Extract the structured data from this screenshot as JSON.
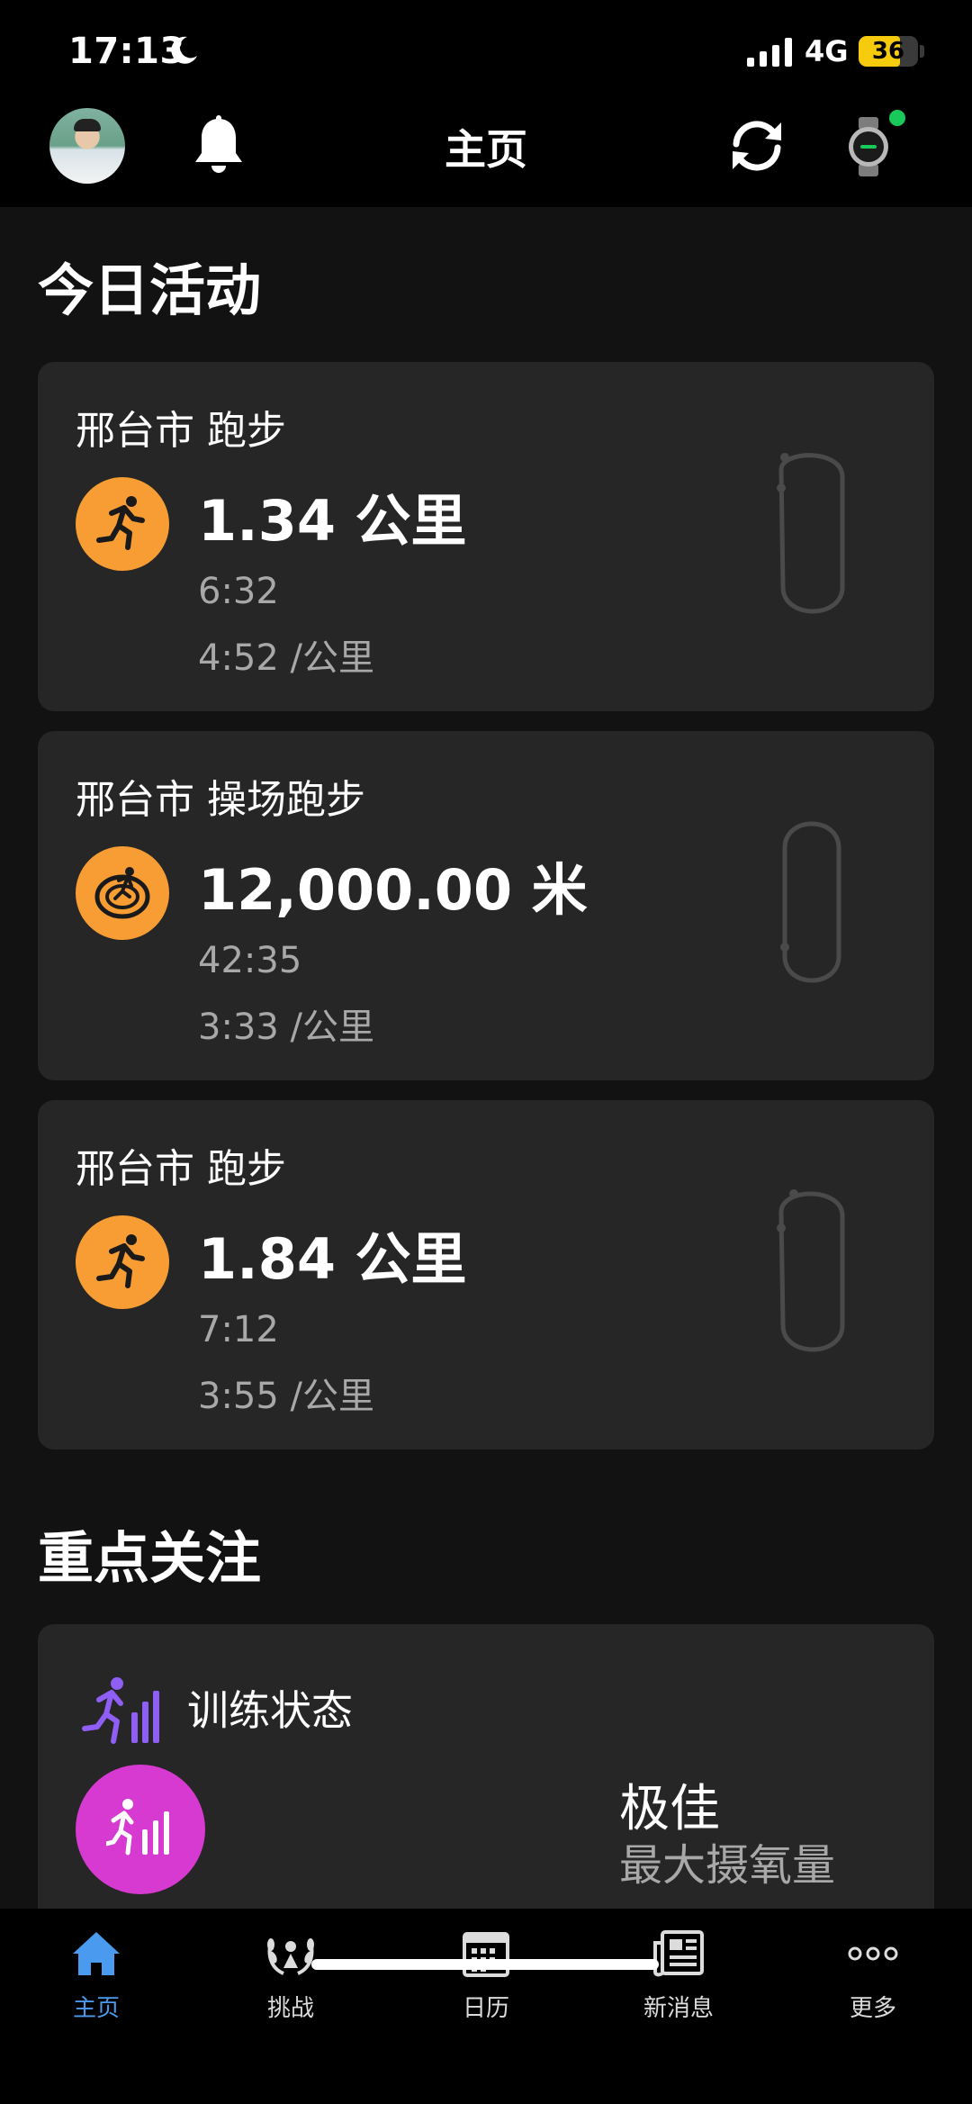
{
  "status_bar": {
    "time": "17:13",
    "network": "4G",
    "battery": "36",
    "battery_level": 0.36
  },
  "header": {
    "title": "主页"
  },
  "today": {
    "section_title": "今日活动",
    "activities": [
      {
        "title": "邢台市 跑步",
        "icon": "run-icon",
        "distance": "1.34 公里",
        "duration": "6:32",
        "pace": "4:52 /公里"
      },
      {
        "title": "邢台市 操场跑步",
        "icon": "track-run-icon",
        "distance": "12,000.00 米",
        "duration": "42:35",
        "pace": "3:33 /公里"
      },
      {
        "title": "邢台市 跑步",
        "icon": "run-icon",
        "distance": "1.84 公里",
        "duration": "7:12",
        "pace": "3:55 /公里"
      }
    ]
  },
  "focus": {
    "section_title": "重点关注",
    "card_label": "训练状态",
    "status": "极佳",
    "subtitle": "最大摄氧量"
  },
  "tabs": [
    {
      "label": "主页",
      "icon": "home-icon",
      "active": true
    },
    {
      "label": "挑战",
      "icon": "laurel-icon",
      "active": false
    },
    {
      "label": "日历",
      "icon": "calendar-icon",
      "active": false
    },
    {
      "label": "新消息",
      "icon": "news-icon",
      "active": false
    },
    {
      "label": "更多",
      "icon": "more-icon",
      "active": false
    }
  ],
  "colors": {
    "accent_orange": "#f89d34",
    "accent_magenta": "#d63ad0",
    "active_tab": "#4a9bf0",
    "battery": "#f5cb0b",
    "watch_dot": "#19c95a"
  }
}
